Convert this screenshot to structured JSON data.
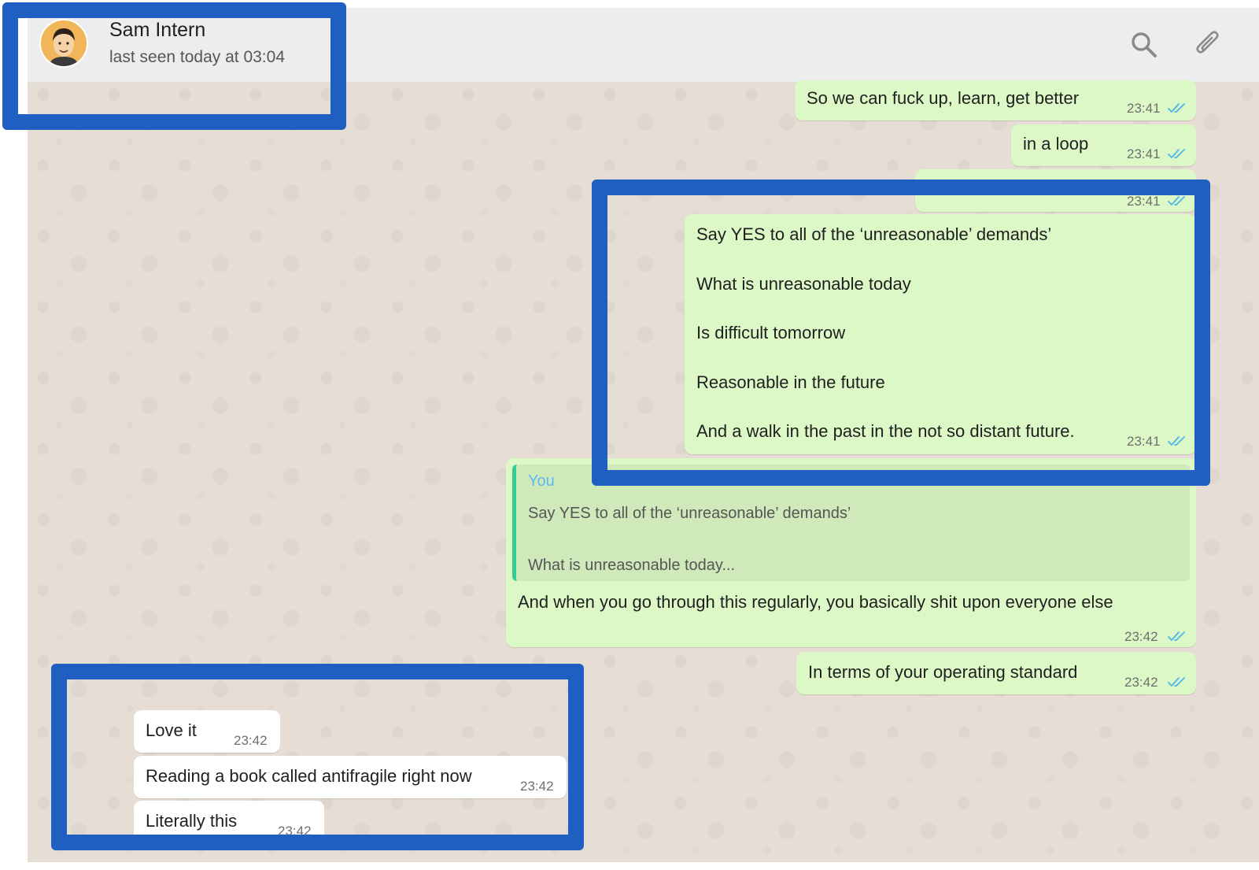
{
  "header": {
    "contact_name": "Sam Intern",
    "status": "last seen today at 03:04",
    "icons": [
      "search-icon",
      "paperclip-icon"
    ]
  },
  "colors": {
    "outgoing_bubble": "#dcf8c6",
    "incoming_bubble": "#ffffff",
    "read_ticks": "#4fb6ec",
    "highlight_box": "#1f5fc1",
    "quote_author": "#5fb9f0",
    "quote_bar": "#35cd96"
  },
  "messages": {
    "m1": {
      "text": "So we can fuck up, learn, get better",
      "time": "23:41"
    },
    "m2": {
      "text": "in a loop",
      "time": "23:41"
    },
    "m3": {
      "time": "23:41"
    },
    "m4": {
      "lines": [
        "Say YES to all of the ‘unreasonable’ demands’",
        "What is unreasonable today",
        "Is difficult tomorrow",
        "Reasonable in the future",
        "And a walk in the past in the not so distant future."
      ],
      "time": "23:41"
    },
    "m5": {
      "quote_author": "You",
      "quote_line_1": "Say YES to all of the ‘unreasonable’ demands’",
      "quote_line_2": "What is unreasonable today...",
      "text": "And when you go through this regularly, you basically shit upon everyone else",
      "time": "23:42"
    },
    "m6": {
      "text": "In terms of your operating standard",
      "time": "23:42"
    },
    "m7": {
      "text": "Love it",
      "time": "23:42"
    },
    "m8": {
      "text": "Reading a book called antifragile right now",
      "time": "23:42"
    },
    "m9": {
      "text": "Literally this",
      "time": "23:42"
    }
  }
}
